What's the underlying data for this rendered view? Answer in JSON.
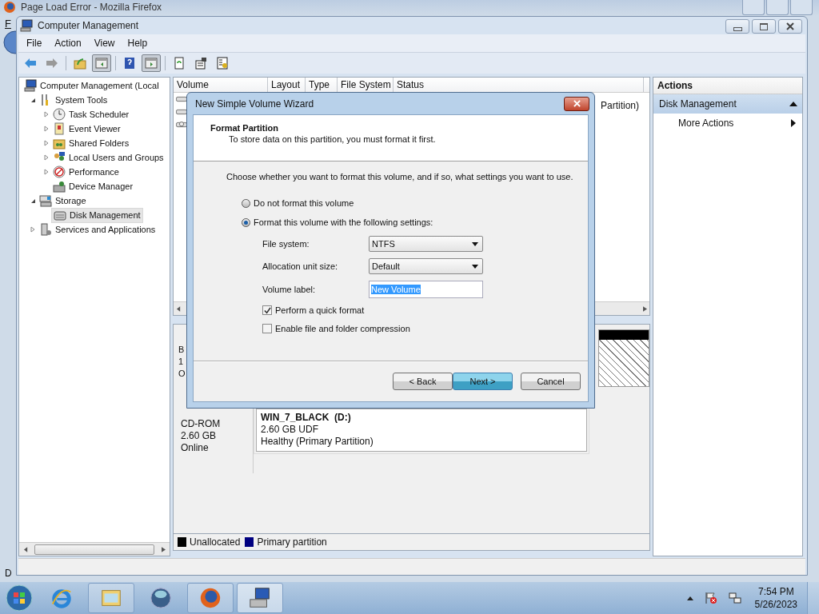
{
  "background_window": {
    "title": "Page Load Error - Mozilla Firefox",
    "menu_fragment": "F",
    "status_fragment": "D"
  },
  "window": {
    "title": "Computer Management"
  },
  "menu": [
    "File",
    "Action",
    "View",
    "Help"
  ],
  "toolbar": [
    {
      "kind": "back",
      "pressed": false
    },
    {
      "kind": "forward",
      "pressed": false
    },
    {
      "kind": "up",
      "pressed": false
    },
    {
      "kind": "tree",
      "pressed": true
    },
    {
      "kind": "help",
      "pressed": false
    },
    {
      "kind": "actionpane",
      "pressed": true
    },
    {
      "kind": "refresh",
      "pressed": false
    },
    {
      "kind": "properties",
      "pressed": false
    },
    {
      "kind": "export",
      "pressed": false
    }
  ],
  "tree": [
    {
      "label": "Computer Management (Local",
      "kind": "computer",
      "selected": false,
      "children": [
        {
          "label": "System Tools",
          "kind": "tools",
          "selected": false,
          "expanded": true,
          "children": [
            {
              "label": "Task Scheduler",
              "kind": "clock",
              "selected": false,
              "expanded": false
            },
            {
              "label": "Event Viewer",
              "kind": "event",
              "selected": false,
              "expanded": false
            },
            {
              "label": "Shared Folders",
              "kind": "folder",
              "selected": false,
              "expanded": false
            },
            {
              "label": "Local Users and Groups",
              "kind": "users",
              "selected": false,
              "expanded": false
            },
            {
              "label": "Performance",
              "kind": "perf",
              "selected": false,
              "expanded": false
            },
            {
              "label": "Device Manager",
              "kind": "device",
              "selected": false
            }
          ]
        },
        {
          "label": "Storage",
          "kind": "storage",
          "selected": false,
          "expanded": true,
          "children": [
            {
              "label": "Disk Management",
              "kind": "disk",
              "selected": true
            }
          ]
        },
        {
          "label": "Services and Applications",
          "kind": "services",
          "selected": false,
          "expanded": false
        }
      ]
    }
  ],
  "volume_list": {
    "columns": [
      "Volume",
      "Layout",
      "Type",
      "File System",
      "Status"
    ],
    "rows": [
      {
        "kind": "disk",
        "status": "Partition)"
      },
      {
        "kind": "disk"
      },
      {
        "kind": "cdrom"
      }
    ]
  },
  "disks": [
    {
      "kind": "basic",
      "label_fragments": [
        "B",
        "1",
        "O"
      ]
    },
    {
      "kind": "cdrom",
      "type": "CD-ROM",
      "size": "2.60 GB",
      "state": "Online",
      "partition": {
        "name": "WIN_7_BLACK  (D:)",
        "size": "2.60 GB UDF",
        "status": "Healthy (Primary Partition)"
      }
    }
  ],
  "legend": [
    {
      "label": "Unallocated",
      "color": "#000000"
    },
    {
      "label": "Primary partition",
      "color": "#000080"
    }
  ],
  "actions": {
    "title": "Actions",
    "section": {
      "label": "Disk Management",
      "expanded": true
    },
    "items": [
      {
        "label": "More Actions"
      }
    ]
  },
  "dialog": {
    "title": "New Simple Volume Wizard",
    "heading": "Format Partition",
    "subheading": "To store data on this partition, you must format it first.",
    "instruction": "Choose whether you want to format this volume, and if so, what settings you want to use.",
    "options": [
      {
        "label": "Do not format this volume",
        "selected": false
      },
      {
        "label": "Format this volume with the following settings:",
        "selected": true
      }
    ],
    "fields": [
      {
        "kind": "dropdown",
        "label": "File system:",
        "value": "NTFS"
      },
      {
        "kind": "dropdown",
        "label": "Allocation unit size:",
        "value": "Default"
      },
      {
        "kind": "text",
        "label": "Volume label:",
        "value": "New Volume",
        "value_selected": true
      }
    ],
    "checkboxes": [
      {
        "label": "Perform a quick format",
        "checked": true
      },
      {
        "label": "Enable file and folder compression",
        "checked": false
      }
    ],
    "buttons": [
      {
        "label": "< Back",
        "default": false
      },
      {
        "label": "Next >",
        "default": true
      },
      {
        "label": "Cancel",
        "default": false
      }
    ]
  },
  "taskbar": {
    "apps": [
      {
        "kind": "ie",
        "running": false,
        "active": false
      },
      {
        "kind": "explorer",
        "running": true,
        "active": false
      },
      {
        "kind": "media",
        "running": false,
        "active": false
      },
      {
        "kind": "firefox",
        "running": true,
        "active": false
      },
      {
        "kind": "computer",
        "running": true,
        "active": true
      }
    ],
    "clock": {
      "time": "7:54 PM",
      "date": "5/26/2023"
    }
  }
}
